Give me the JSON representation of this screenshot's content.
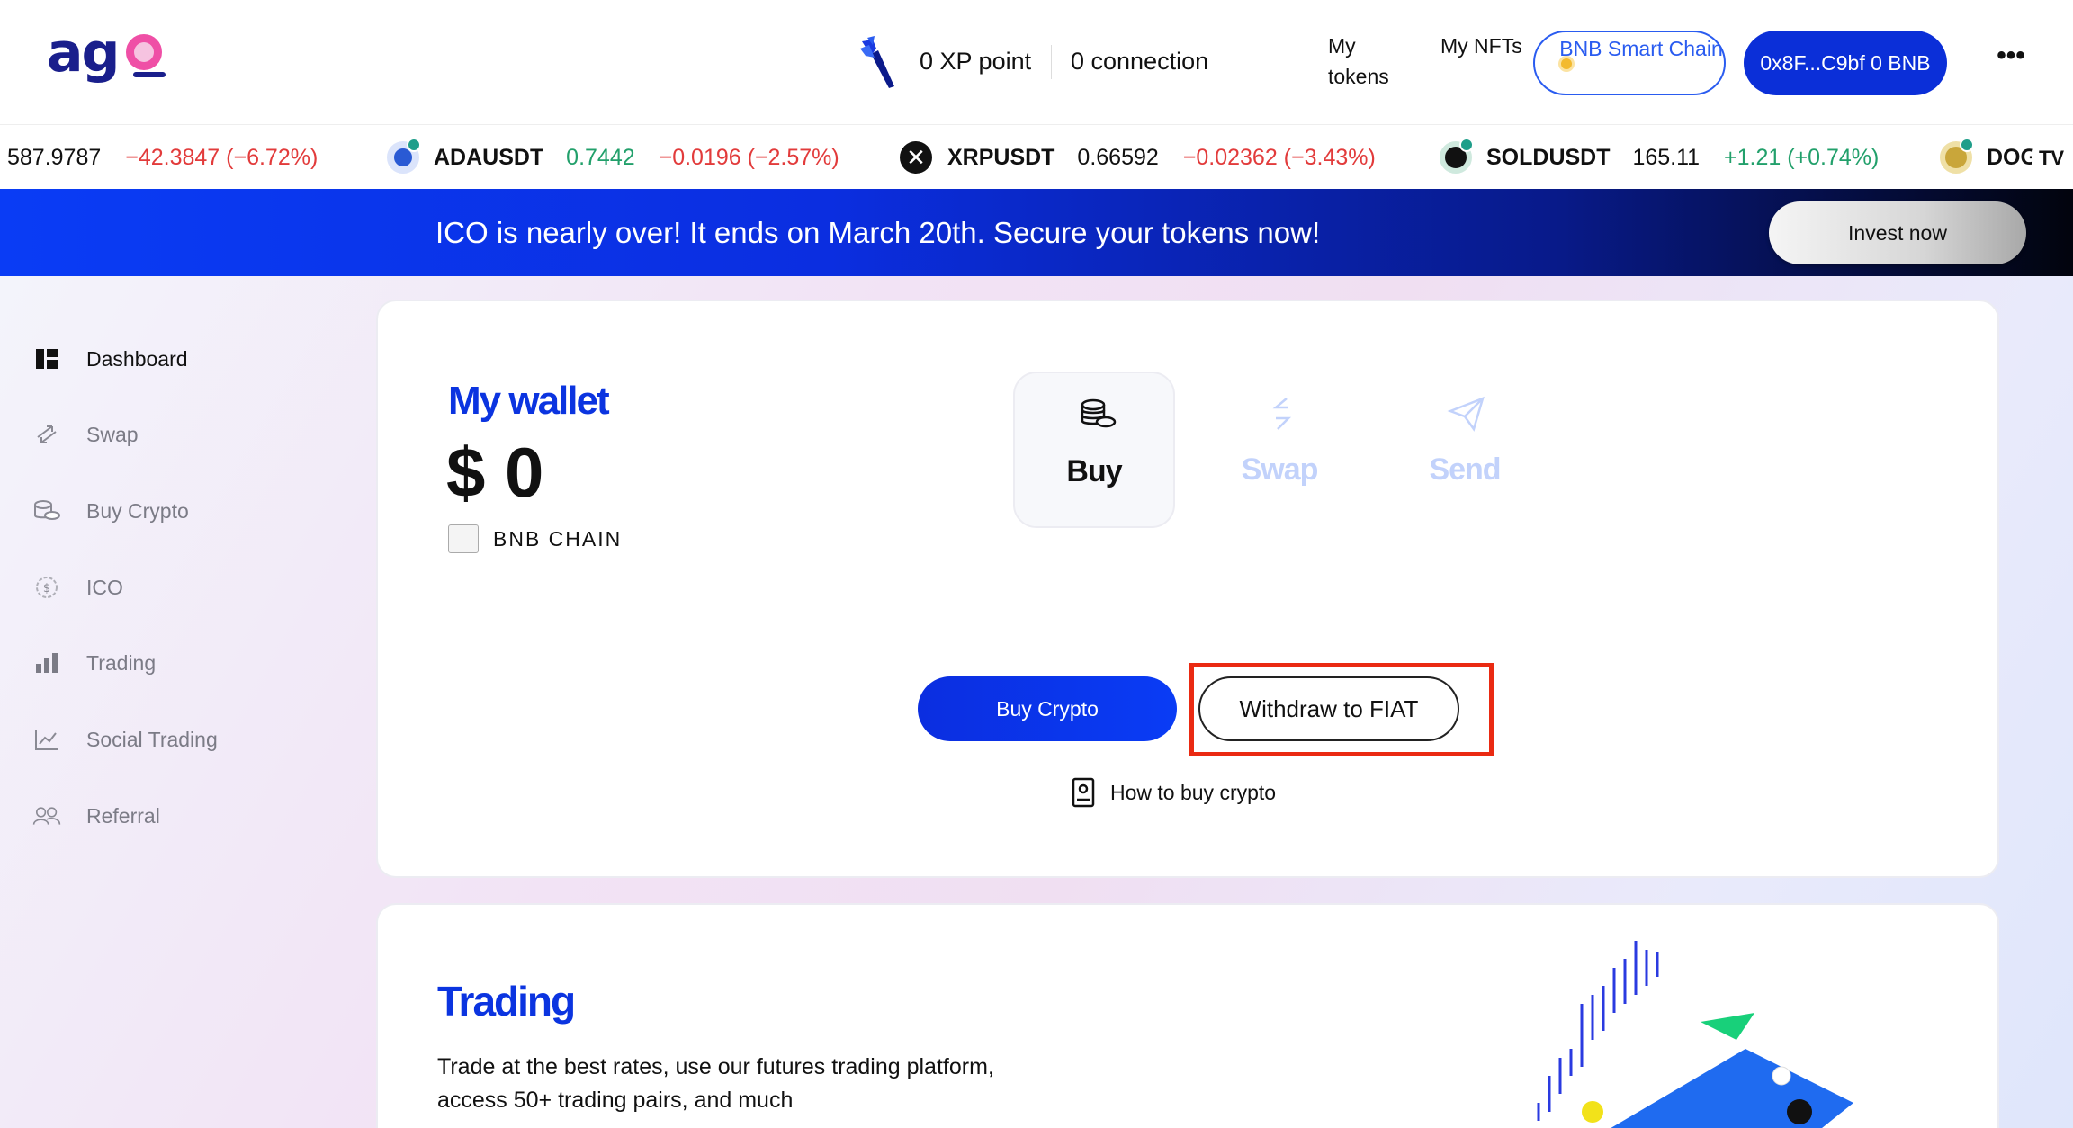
{
  "header": {
    "logo_text": "ag",
    "xp_label": "0 XP point",
    "connection_label": "0 connection",
    "nav": {
      "my_tokens": "My tokens",
      "my_nfts": "My NFTs"
    },
    "chain_button": "BNB Smart Chain",
    "address_button": "0x8F...C9bf 0 BNB",
    "more_label": "•••"
  },
  "ticker": [
    {
      "symbol": "",
      "price": "587.9787",
      "change": "−42.3847 (−6.72%)",
      "trend": "down"
    },
    {
      "symbol": "ADAUSDT",
      "price": "0.7442",
      "change": "−0.0196 (−2.57%)",
      "trend": "down",
      "price_trend": "up"
    },
    {
      "symbol": "XRPUSDT",
      "price": "0.66592",
      "change": "−0.02362 (−3.43%)",
      "trend": "down"
    },
    {
      "symbol": "SOLDUSDT",
      "price": "165.11",
      "change": "+1.21 (+0.74%)",
      "trend": "up"
    },
    {
      "symbol": "DOG",
      "price": "",
      "change": "",
      "trend": "none"
    }
  ],
  "ticker_logo": "TV",
  "banner": {
    "text": "ICO is nearly over! It ends on March 20th. Secure your tokens now!",
    "button": "Invest now"
  },
  "sidebar": {
    "items": [
      {
        "label": "Dashboard",
        "icon": "dashboard-icon",
        "active": true
      },
      {
        "label": "Swap",
        "icon": "swap-icon"
      },
      {
        "label": "Buy Crypto",
        "icon": "coins-icon"
      },
      {
        "label": "ICO",
        "icon": "ico-coin-icon"
      },
      {
        "label": "Trading",
        "icon": "bar-chart-icon"
      },
      {
        "label": "Social Trading",
        "icon": "line-chart-icon"
      },
      {
        "label": "Referral",
        "icon": "users-icon"
      }
    ]
  },
  "wallet": {
    "title": "My wallet",
    "balance": "$ 0",
    "chain_name": "BNB CHAIN",
    "actions": {
      "buy": "Buy",
      "swap": "Swap",
      "send": "Send"
    },
    "buy_crypto_button": "Buy Crypto",
    "withdraw_button": "Withdraw to FIAT",
    "how_to_label": "How to buy crypto"
  },
  "trading": {
    "title": "Trading",
    "description": "Trade at the best rates, use our futures trading platform, access 50+ trading pairs, and much"
  },
  "colors": {
    "brand_blue": "#0b34e0",
    "logo_navy": "#1a1f8c",
    "logo_pink": "#ef4fa6",
    "positive": "#22a06b",
    "negative": "#e23b3b",
    "highlight_red": "#ea2a12"
  }
}
